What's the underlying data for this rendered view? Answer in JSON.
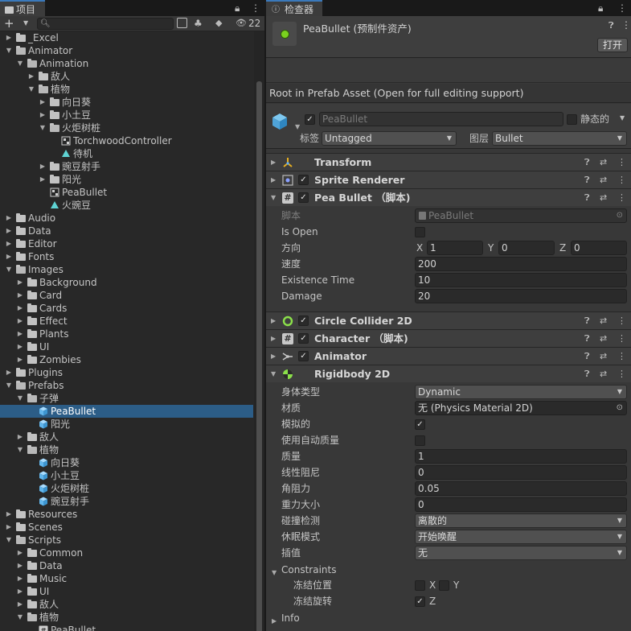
{
  "project": {
    "tab_label": "项目",
    "add_label": "+",
    "hidden_count": "22",
    "search_placeholder": "",
    "tree": [
      {
        "label": "_Excel",
        "indent": 0,
        "type": "folder",
        "expanded": false
      },
      {
        "label": "Animator",
        "indent": 0,
        "type": "folder",
        "expanded": true
      },
      {
        "label": "Animation",
        "indent": 1,
        "type": "folder",
        "expanded": true
      },
      {
        "label": "敌人",
        "indent": 2,
        "type": "folder",
        "expanded": false
      },
      {
        "label": "植物",
        "indent": 2,
        "type": "folder",
        "expanded": true
      },
      {
        "label": "向日葵",
        "indent": 3,
        "type": "folder",
        "expanded": false
      },
      {
        "label": "小土豆",
        "indent": 3,
        "type": "folder",
        "expanded": false
      },
      {
        "label": "火炬树桩",
        "indent": 3,
        "type": "folder",
        "expanded": true
      },
      {
        "label": "TorchwoodController",
        "indent": 4,
        "type": "controller"
      },
      {
        "label": "待机",
        "indent": 4,
        "type": "anim"
      },
      {
        "label": "豌豆射手",
        "indent": 3,
        "type": "folder",
        "expanded": false
      },
      {
        "label": "阳光",
        "indent": 3,
        "type": "folder",
        "expanded": false
      },
      {
        "label": "PeaBullet",
        "indent": 3,
        "type": "controller"
      },
      {
        "label": "火豌豆",
        "indent": 3,
        "type": "anim"
      },
      {
        "label": "Audio",
        "indent": 0,
        "type": "folder",
        "expanded": false
      },
      {
        "label": "Data",
        "indent": 0,
        "type": "folder",
        "expanded": false
      },
      {
        "label": "Editor",
        "indent": 0,
        "type": "folder",
        "expanded": false
      },
      {
        "label": "Fonts",
        "indent": 0,
        "type": "folder",
        "expanded": false
      },
      {
        "label": "Images",
        "indent": 0,
        "type": "folder",
        "expanded": true
      },
      {
        "label": "Background",
        "indent": 1,
        "type": "folder",
        "expanded": false
      },
      {
        "label": "Card",
        "indent": 1,
        "type": "folder",
        "expanded": false
      },
      {
        "label": "Cards",
        "indent": 1,
        "type": "folder",
        "expanded": false
      },
      {
        "label": "Effect",
        "indent": 1,
        "type": "folder",
        "expanded": false
      },
      {
        "label": "Plants",
        "indent": 1,
        "type": "folder",
        "expanded": false
      },
      {
        "label": "UI",
        "indent": 1,
        "type": "folder",
        "expanded": false
      },
      {
        "label": "Zombies",
        "indent": 1,
        "type": "folder",
        "expanded": false
      },
      {
        "label": "Plugins",
        "indent": 0,
        "type": "folder",
        "expanded": false
      },
      {
        "label": "Prefabs",
        "indent": 0,
        "type": "folder",
        "expanded": true
      },
      {
        "label": "子弹",
        "indent": 1,
        "type": "folder",
        "expanded": true
      },
      {
        "label": "PeaBullet",
        "indent": 2,
        "type": "prefab",
        "selected": true
      },
      {
        "label": "阳光",
        "indent": 2,
        "type": "prefab"
      },
      {
        "label": "敌人",
        "indent": 1,
        "type": "folder",
        "expanded": false
      },
      {
        "label": "植物",
        "indent": 1,
        "type": "folder",
        "expanded": true
      },
      {
        "label": "向日葵",
        "indent": 2,
        "type": "prefab"
      },
      {
        "label": "小土豆",
        "indent": 2,
        "type": "prefab"
      },
      {
        "label": "火炬树桩",
        "indent": 2,
        "type": "prefab"
      },
      {
        "label": "豌豆射手",
        "indent": 2,
        "type": "prefab"
      },
      {
        "label": "Resources",
        "indent": 0,
        "type": "folder",
        "expanded": false
      },
      {
        "label": "Scenes",
        "indent": 0,
        "type": "folder",
        "expanded": false
      },
      {
        "label": "Scripts",
        "indent": 0,
        "type": "folder",
        "expanded": true
      },
      {
        "label": "Common",
        "indent": 1,
        "type": "folder",
        "expanded": false
      },
      {
        "label": "Data",
        "indent": 1,
        "type": "folder",
        "expanded": false
      },
      {
        "label": "Music",
        "indent": 1,
        "type": "folder",
        "expanded": false
      },
      {
        "label": "UI",
        "indent": 1,
        "type": "folder",
        "expanded": false
      },
      {
        "label": "敌人",
        "indent": 1,
        "type": "folder",
        "expanded": false
      },
      {
        "label": "植物",
        "indent": 1,
        "type": "folder",
        "expanded": true
      },
      {
        "label": "PeaBullet",
        "indent": 2,
        "type": "script"
      }
    ]
  },
  "inspector": {
    "tab_label": "检查器",
    "asset_title": "PeaBullet (预制件资产)",
    "open_button": "打开",
    "root_note": "Root in Prefab Asset (Open for full editing support)",
    "object_name": "PeaBullet",
    "static_label": "静态的",
    "tag_label": "标签",
    "tag_value": "Untagged",
    "layer_label": "图层",
    "layer_value": "Bullet",
    "components": {
      "transform": "Transform",
      "sprite_renderer": "Sprite Renderer",
      "pea_bullet": "Pea Bullet （脚本)",
      "circle_collider": "Circle Collider 2D",
      "character": "Character （脚本)",
      "animator": "Animator",
      "rigidbody": "Rigidbody 2D"
    },
    "pea_bullet_fields": {
      "script_label": "脚本",
      "script_value": "PeaBullet",
      "is_open_label": "Is Open",
      "direction_label": "方向",
      "x_label": "X",
      "x_value": "1",
      "y_label": "Y",
      "y_value": "0",
      "z_label": "Z",
      "z_value": "0",
      "speed_label": "速度",
      "speed_value": "200",
      "existence_label": "Existence Time",
      "existence_value": "10",
      "damage_label": "Damage",
      "damage_value": "20"
    },
    "rigidbody_fields": {
      "body_type_label": "身体类型",
      "body_type_value": "Dynamic",
      "material_label": "材质",
      "material_value": "无 (Physics Material 2D)",
      "simulated_label": "模拟的",
      "auto_mass_label": "使用自动质量",
      "mass_label": "质量",
      "mass_value": "1",
      "linear_drag_label": "线性阻尼",
      "linear_drag_value": "0",
      "angular_drag_label": "角阻力",
      "angular_drag_value": "0.05",
      "gravity_label": "重力大小",
      "gravity_value": "0",
      "collision_label": "碰撞检测",
      "collision_value": "离散的",
      "sleep_label": "休眠模式",
      "sleep_value": "开始唤醒",
      "interp_label": "插值",
      "interp_value": "无",
      "constraints_label": "Constraints",
      "freeze_pos_label": "冻结位置",
      "freeze_x": "X",
      "freeze_y": "Y",
      "freeze_rot_label": "冻结旋转",
      "freeze_z": "Z",
      "info_label": "Info"
    }
  }
}
